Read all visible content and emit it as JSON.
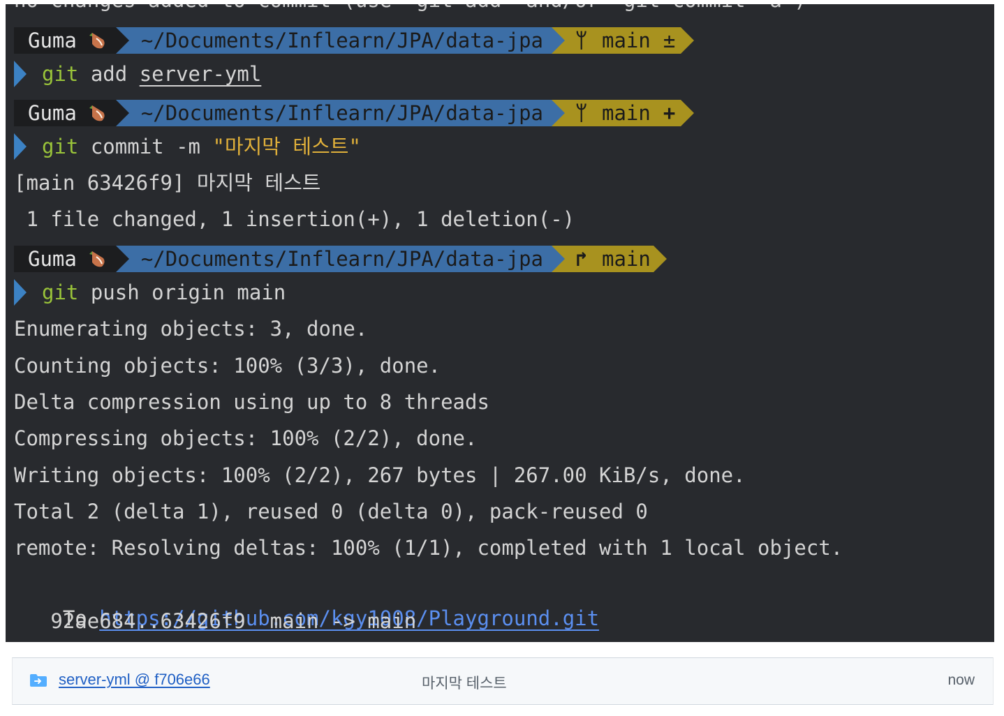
{
  "terminal": {
    "cut_top_line": "no changes added to commit (use \"git add\" and/or \"git commit -a\")",
    "prompt_user": "Guma",
    "prompt_path": "~/Documents/Inflearn/JPA/data-jpa",
    "prompts": [
      {
        "branch": "main",
        "suffix": "±"
      },
      {
        "branch": "main",
        "suffix": "+"
      },
      {
        "branch": "main",
        "suffix": ""
      }
    ],
    "cmd1": {
      "kw": "git",
      "rest": " add ",
      "arg": "server-yml"
    },
    "cmd2": {
      "kw": "git",
      "rest": " commit -m ",
      "str": "\"마지막 테스트\""
    },
    "commit_out": [
      "[main 63426f9] 마지막 테스트",
      " 1 file changed, 1 insertion(+), 1 deletion(-)"
    ],
    "cmd3": {
      "kw": "git",
      "rest": " push origin main"
    },
    "push_out": [
      "Enumerating objects: 3, done.",
      "Counting objects: 100% (3/3), done.",
      "Delta compression using up to 8 threads",
      "Compressing objects: 100% (2/2), done.",
      "Writing objects: 100% (2/2), 267 bytes | 267.00 KiB/s, done.",
      "Total 2 (delta 1), reused 0 (delta 0), pack-reused 0",
      "remote: Resolving deltas: 100% (1/1), completed with 1 local object."
    ],
    "to_label": "To ",
    "remote_url": "https://github.com/kgy1008/Playground.git",
    "ref_update": "   92ae684..63426f9  main -> main"
  },
  "commit_row": {
    "icon": "submodule-folder-icon",
    "link": "server-yml @ f706e66",
    "message": "마지막 테스트",
    "time": "now"
  },
  "colors": {
    "terminal_bg": "#282a2e",
    "path_segment": "#3c6ea6",
    "git_segment": "#a8921f",
    "keyword": "#9ac43a",
    "string": "#e0b03a",
    "link": "#5b8ff0"
  }
}
